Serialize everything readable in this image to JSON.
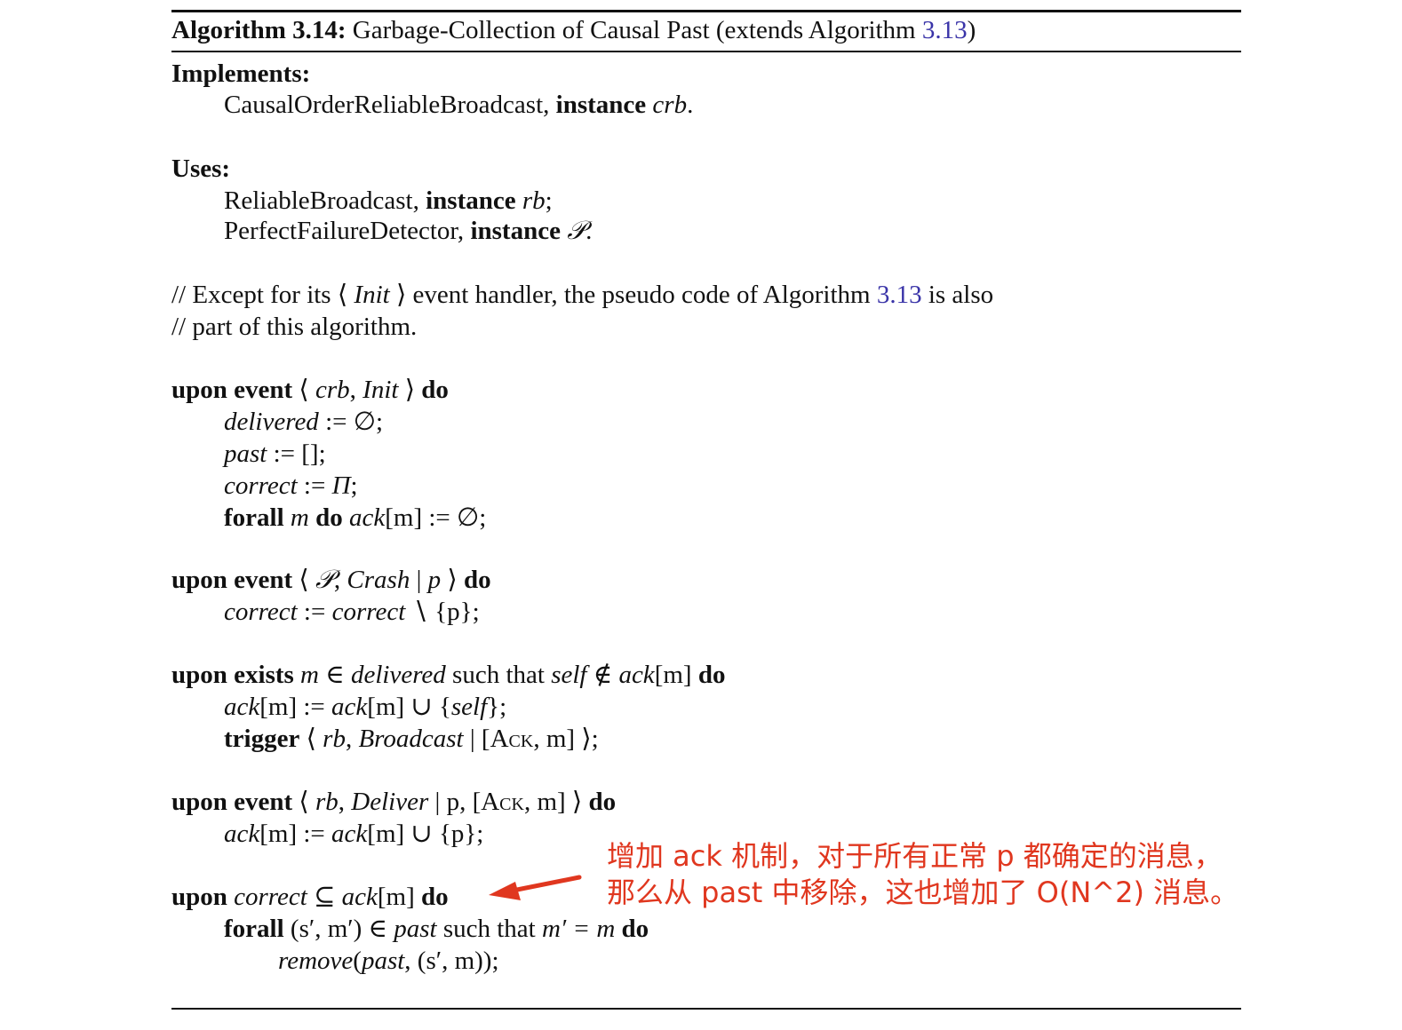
{
  "algorithm": {
    "label": "Algorithm 3.14:",
    "title": "Garbage-Collection of Causal Past (extends Algorithm",
    "ref": "3.13",
    "title_close": ")"
  },
  "implements": {
    "heading": "Implements:",
    "abstraction": "CausalOrderReliableBroadcast,",
    "kw_instance": "instance",
    "name": "crb",
    "end": "."
  },
  "uses": {
    "heading": "Uses:",
    "items": [
      {
        "abstraction": "ReliableBroadcast,",
        "kw": "instance",
        "name": "rb",
        "end": ";"
      },
      {
        "abstraction": "PerfectFailureDetector,",
        "kw": "instance",
        "name": "𝒫",
        "end": "."
      }
    ]
  },
  "comment": {
    "line1_a": "// Except for its ⟨",
    "line1_init": "Init",
    "line1_b": "⟩ event handler, the pseudo code of Algorithm",
    "line1_ref": "3.13",
    "line1_c": "is also",
    "line2": "// part of this algorithm."
  },
  "handler_init": {
    "kw_upon": "upon event",
    "open": "⟨",
    "inst": "crb",
    "comma": ",",
    "event": "Init",
    "close": "⟩",
    "kw_do": "do",
    "l1_var": "delivered",
    "l1_rest": ":= ∅;",
    "l2_var": "past",
    "l2_rest": ":= [];",
    "l3_var": "correct",
    "l3_assign": ":=",
    "l3_val": "Π",
    "l3_end": ";",
    "l4_kw": "forall",
    "l4_m": "m",
    "l4_do": "do",
    "l4_ack": "ack",
    "l4_rest": "[m] := ∅;"
  },
  "handler_crash": {
    "kw_upon": "upon event",
    "open": "⟨",
    "inst": "𝒫",
    "comma": ",",
    "event": "Crash",
    "bar": "|",
    "p": "p",
    "close": "⟩",
    "kw_do": "do",
    "body_var": "correct",
    "body_assign": ":=",
    "body_var2": "correct",
    "body_rest": "∖ {p};"
  },
  "handler_exists": {
    "kw": "upon exists",
    "m": "m",
    "in": "∈",
    "set": "delivered",
    "such": "such that",
    "self": "self",
    "notin": "∉",
    "ack": "ack",
    "idx": "[m]",
    "kw_do": "do",
    "l1_ack": "ack",
    "l1_a": "[m] :=",
    "l1_ack2": "ack",
    "l1_b": "[m] ∪ {",
    "l1_self": "self",
    "l1_c": "};",
    "l2_kw": "trigger",
    "l2_open": "⟨",
    "l2_inst": "rb",
    "l2_comma": ",",
    "l2_event": "Broadcast",
    "l2_bar": "| [",
    "l2_msg": "Ack",
    "l2_rest": ", m] ⟩;"
  },
  "handler_deliver": {
    "kw_upon": "upon event",
    "open": "⟨",
    "inst": "rb",
    "comma": ",",
    "event": "Deliver",
    "rest_a": "| p, [",
    "msg": "Ack",
    "rest_b": ", m] ⟩",
    "kw_do": "do",
    "l1_ack": "ack",
    "l1_a": "[m] :=",
    "l1_ack2": "ack",
    "l1_b": "[m] ∪ {p};"
  },
  "handler_correct": {
    "kw": "upon",
    "var": "correct",
    "subset": "⊆",
    "ack": "ack",
    "idx": "[m]",
    "kw_do": "do",
    "l1_kw": "forall",
    "l1_a": "(s′, m′) ∈",
    "l1_past": "past",
    "l1_such": "such that",
    "l1_b": "m′ = m",
    "l1_do": "do",
    "l2_fn": "remove",
    "l2_a": "(",
    "l2_past": "past",
    "l2_b": ", (s′, m));"
  },
  "annotation": {
    "line1": "增加 ack 机制，对于所有正常 p 都确定的消息，",
    "line2": "那么从 past 中移除，这也增加了 O(N^2) 消息。",
    "color": "#e0371f"
  }
}
